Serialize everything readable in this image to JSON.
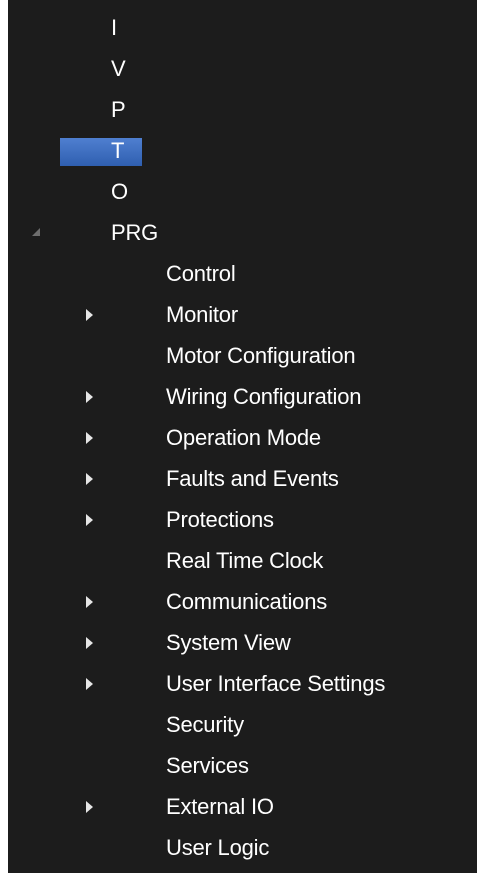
{
  "tree": {
    "top_items": [
      {
        "label": "I"
      },
      {
        "label": "V"
      },
      {
        "label": "P"
      },
      {
        "label": "T",
        "selected": true
      },
      {
        "label": "O"
      },
      {
        "label": "PRG",
        "expanded": true
      }
    ],
    "prg_children": [
      {
        "label": "Control",
        "has_children": false
      },
      {
        "label": "Monitor",
        "has_children": true
      },
      {
        "label": "Motor Configuration",
        "has_children": false
      },
      {
        "label": "Wiring Configuration",
        "has_children": true
      },
      {
        "label": "Operation Mode",
        "has_children": true
      },
      {
        "label": "Faults and Events",
        "has_children": true
      },
      {
        "label": "Protections",
        "has_children": true
      },
      {
        "label": "Real Time Clock",
        "has_children": false
      },
      {
        "label": "Communications",
        "has_children": true
      },
      {
        "label": "System View",
        "has_children": true
      },
      {
        "label": "User Interface Settings",
        "has_children": true
      },
      {
        "label": "Security",
        "has_children": false
      },
      {
        "label": "Services",
        "has_children": false
      },
      {
        "label": "External IO",
        "has_children": true
      },
      {
        "label": "User Logic",
        "has_children": false
      }
    ],
    "icons": {
      "expanded": "expanded-triangle-icon",
      "collapsed": "expand-arrow-icon"
    },
    "colors": {
      "background": "#1c1c1c",
      "text": "#ffffff",
      "selection": "#3b6cc0"
    }
  }
}
